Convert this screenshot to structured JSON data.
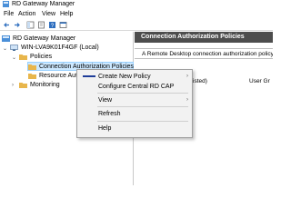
{
  "window": {
    "title": "RD Gateway Manager",
    "icon": "rd-gateway-icon"
  },
  "menubar": {
    "items": [
      "File",
      "Action",
      "View",
      "Help"
    ]
  },
  "toolbar": {
    "buttons": [
      "back-icon",
      "forward-icon",
      "show-tree-icon",
      "properties-icon",
      "help-icon",
      "console-icon"
    ]
  },
  "tree": {
    "root": "RD Gateway Manager",
    "server": "WIN-LVA9K01F4GF (Local)",
    "policies": "Policies",
    "cap": "Connection Authorization Policies",
    "rap": "Resource Authorization Policies",
    "monitoring": "Monitoring"
  },
  "right_pane": {
    "header": "Connection Authorization Policies",
    "description": "A Remote Desktop connection authorization policy (RD CAP)",
    "col_order": "Listed in Order Listed)",
    "col_user": "User Gr"
  },
  "context_menu": {
    "items": [
      {
        "label": "Create New Policy",
        "submenu": true
      },
      {
        "label": "Configure Central RD CAP",
        "submenu": false
      },
      {
        "label": "View",
        "submenu": true
      },
      {
        "label": "Refresh",
        "submenu": false
      },
      {
        "label": "Help",
        "submenu": false
      }
    ],
    "submenu_arrow": "›"
  },
  "colors": {
    "accent": "#0078d7",
    "header_bg": "#4d4d4d",
    "selection": "#cce8ff",
    "folder": "#e8b64c"
  }
}
